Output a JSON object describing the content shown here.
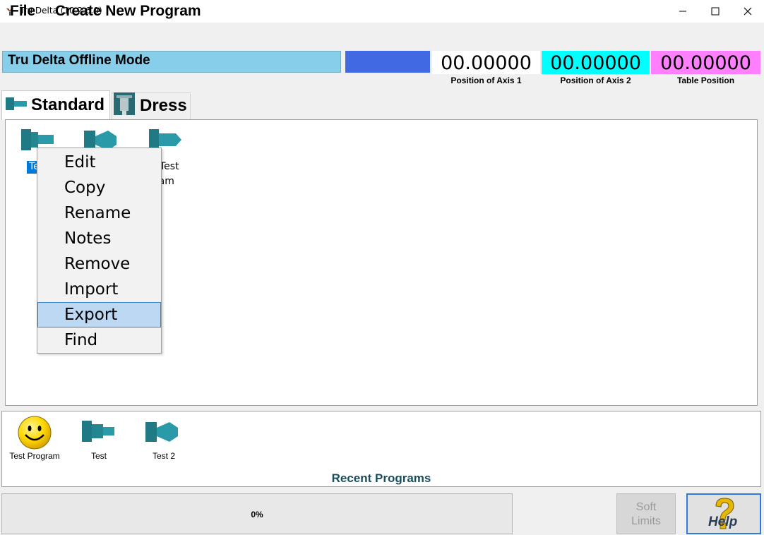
{
  "window": {
    "title": "Tru Delta (10.2.6.0)",
    "controls": {
      "minimize_icon": "minimize-icon",
      "maximize_icon": "maximize-icon",
      "close_icon": "close-icon"
    }
  },
  "menu": {
    "file": "File",
    "create": "Create New Program"
  },
  "status": {
    "mode": "Tru Delta Offline Mode",
    "axis1_value": "00.00000",
    "axis1_label": "Position of Axis 1",
    "axis2_value": "00.00000",
    "axis2_label": "Position of Axis 2",
    "table_value": "00.00000",
    "table_label": "Table Position",
    "colors": {
      "mode_bg": "#87ceeb",
      "block": "#4169e1",
      "axis1_bg": "#ffffff",
      "axis2_bg": "#00ffff",
      "table_bg": "#ff80ff"
    }
  },
  "tabs": [
    {
      "label": "Standard",
      "icon": "wheel-icon",
      "active": true
    },
    {
      "label": "Dress",
      "icon": "dress-icon",
      "active": false
    }
  ],
  "grid": {
    "items": [
      {
        "label_visible": "Te",
        "icon": "wheel-icon",
        "selected": true
      },
      {
        "icon": "wheel-icon-flared"
      },
      {
        "label_line1": "Test",
        "label_line2": "gram",
        "icon": "wheel-icon"
      }
    ]
  },
  "context_menu": {
    "items": [
      "Edit",
      "Copy",
      "Rename",
      "Notes",
      "Remove",
      "Import",
      "Export",
      "Find"
    ],
    "highlighted": "Export"
  },
  "recent": {
    "title": "Recent Programs",
    "items": [
      {
        "label": "Test Program",
        "icon": "smiley-icon"
      },
      {
        "label": "Test",
        "icon": "wheel-icon"
      },
      {
        "label": "Test 2",
        "icon": "wheel-icon-flared"
      }
    ]
  },
  "bottom": {
    "progress_text": "0%",
    "progress_fraction": 0,
    "soft_limits_line1": "Soft",
    "soft_limits_line2": "Limits",
    "help_label": "Help",
    "help_icon": "question-icon"
  }
}
